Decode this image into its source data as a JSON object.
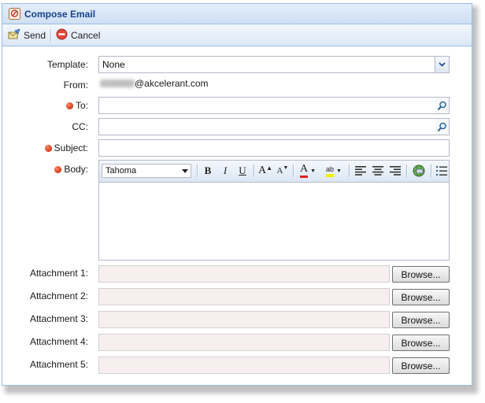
{
  "window": {
    "title": "Compose Email"
  },
  "toolbar": {
    "send_label": "Send",
    "cancel_label": "Cancel"
  },
  "form": {
    "template_label": "Template:",
    "template_value": "None",
    "from_label": "From:",
    "from_value": "@akcelerant.com",
    "to_label": "To:",
    "to_value": "",
    "cc_label": "CC:",
    "cc_value": "",
    "subject_label": "Subject:",
    "subject_value": "",
    "body_label": "Body:"
  },
  "editor": {
    "font_name": "Tahoma",
    "bold": "B",
    "italic": "I",
    "underline": "U",
    "grow_font": "A",
    "shrink_font": "A",
    "font_color": "A",
    "highlight": "ab"
  },
  "attachments": {
    "label_1": "Attachment 1:",
    "label_2": "Attachment 2:",
    "label_3": "Attachment 3:",
    "label_4": "Attachment 4:",
    "label_5": "Attachment 5:",
    "browse_label": "Browse..."
  },
  "colors": {
    "required_dot": "#d8350f",
    "title_text": "#15428b",
    "border": "#99bbe8"
  }
}
